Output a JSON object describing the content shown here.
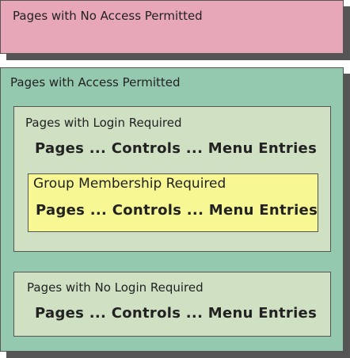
{
  "no_access": {
    "title": "Pages with No Access Permitted",
    "color": "#e8a7b8"
  },
  "access": {
    "title": "Pages with Access Permitted",
    "color": "#94c9b0",
    "login_required": {
      "title": "Pages with Login Required",
      "entries": "Pages ... Controls ... Menu Entries",
      "color": "#cfe0c3",
      "group_membership": {
        "title": "Group Membership Required",
        "entries": "Pages ... Controls ... Menu Entries",
        "color": "#f7f794"
      }
    },
    "no_login_required": {
      "title": "Pages with No Login Required",
      "entries": "Pages ... Controls ... Menu Entries",
      "color": "#cfe0c3"
    }
  }
}
